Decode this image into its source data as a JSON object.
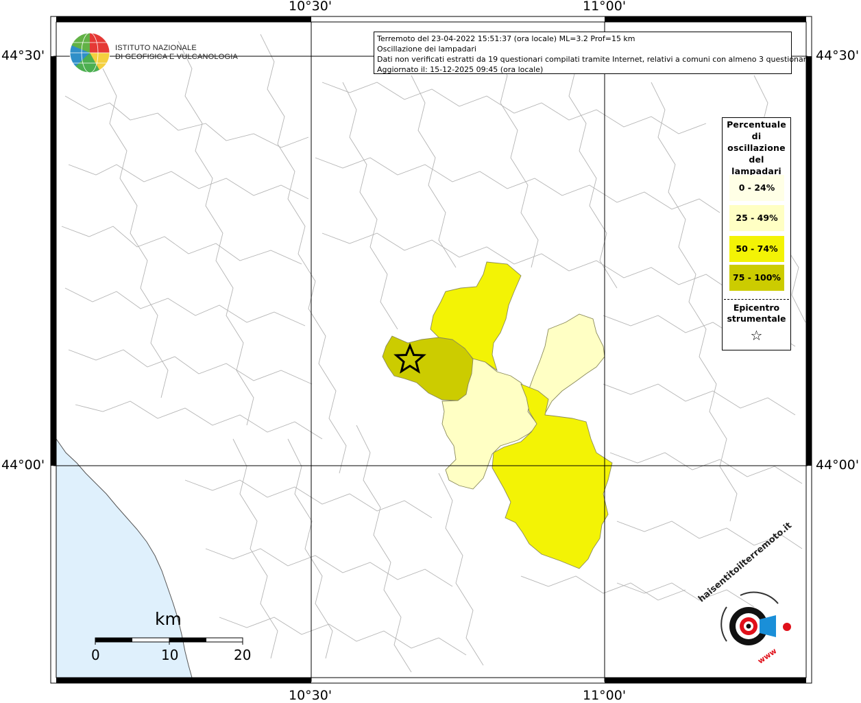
{
  "grid": {
    "top_labels": [
      "10°30'",
      "11°00'"
    ],
    "bottom_labels": [
      "10°30'",
      "11°00'"
    ],
    "left_labels": [
      "44°30'",
      "44°00'"
    ],
    "right_labels": [
      "44°30'",
      "44°00'"
    ]
  },
  "logo": {
    "org_line1": "ISTITUTO NAZIONALE",
    "org_line2": "DI GEOFISICA E VULCANOLOGIA",
    "icon": "ingv-globe-icon"
  },
  "info": {
    "line1": "Terremoto del 23-04-2022 15:51:37 (ora locale) ML=3.2 Prof=15 km",
    "line2": "Oscillazione dei lampadari",
    "line3": "Dati non verificati estratti da 19 questionari compilati tramite Internet, relativi a comuni con almeno 3 questionari.",
    "line4": "Aggiornato il: 15-12-2025 09:45 (ora locale)"
  },
  "legend": {
    "title_lines": [
      "Percentuale",
      "di",
      "oscillazione",
      "del",
      "lampadari"
    ],
    "classes": [
      {
        "label": "0 - 24%",
        "color": "#ffffe6"
      },
      {
        "label": "25 - 49%",
        "color": "#ffffc4"
      },
      {
        "label": "50 - 74%",
        "color": "#f3f305"
      },
      {
        "label": "75 - 100%",
        "color": "#cccc00"
      }
    ],
    "epicenter_line1": "Epicentro",
    "epicenter_line2": "strumentale",
    "epicenter_symbol": "☆"
  },
  "map": {
    "sea_color": "#dff0fc",
    "boundary_color": "#b4b4b4",
    "epicenter_icon": "star-icon"
  },
  "scale": {
    "unit": "km",
    "labels": [
      "0",
      "10",
      "20"
    ]
  },
  "watermark": {
    "text": "haisentitoilterremoto.it",
    "url_text": "www",
    "icon": "haisentito-logo-icon"
  }
}
